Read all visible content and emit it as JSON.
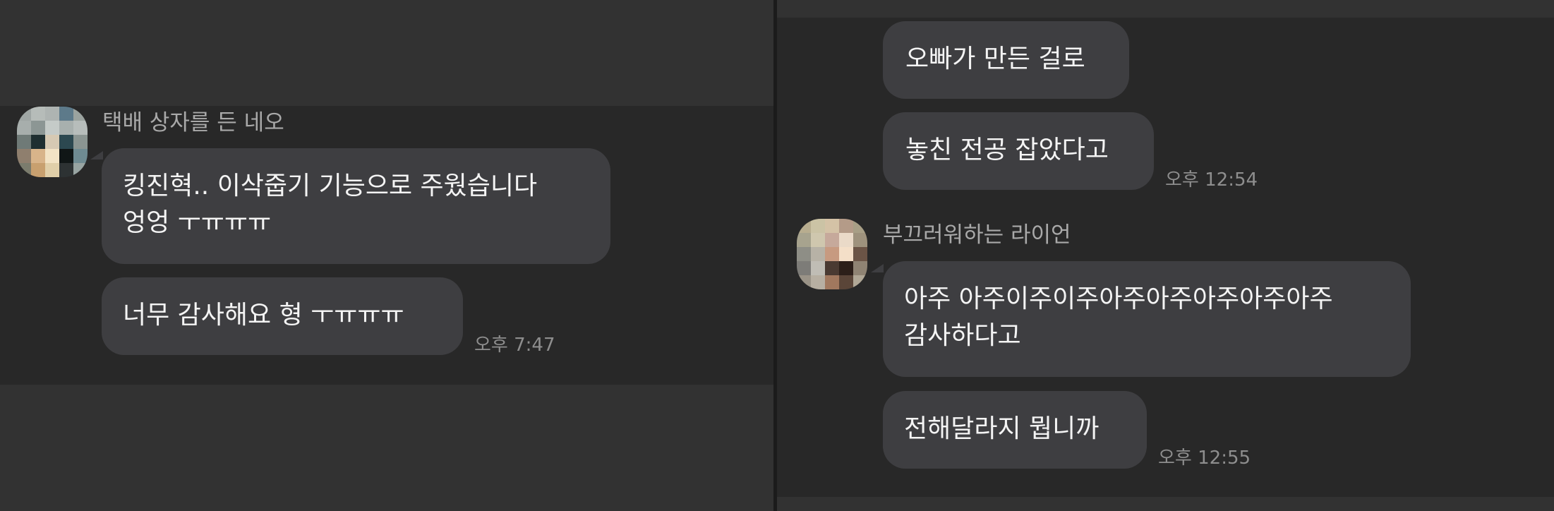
{
  "left_chat": {
    "sender_name": "택배 상자를 든 네오",
    "messages": [
      {
        "lines": [
          "킹진혁.. 이삭줍기 기능으로 주웠습니다",
          "엉엉 ㅜㅠㅠㅠ"
        ]
      },
      {
        "lines": [
          "너무 감사해요 형 ㅜㅠㅠㅠ"
        ]
      }
    ],
    "time": "오후 7:47"
  },
  "right_chat": {
    "group1": {
      "messages": [
        {
          "lines": [
            "오빠가 만든 걸로"
          ]
        },
        {
          "lines": [
            "놓친 전공 잡았다고"
          ]
        }
      ],
      "time": "오후 12:54"
    },
    "group2": {
      "sender_name": "부끄러워하는 라이언",
      "messages": [
        {
          "lines": [
            "아주 아주이주이주아주아주아주아주아주",
            "감사하다고"
          ]
        },
        {
          "lines": [
            "전해달라지 뭡니까"
          ]
        }
      ],
      "time": "오후 12:55"
    }
  },
  "colors": {
    "background": "#323232",
    "message_band": "#282828",
    "bubble": "#3e3e41",
    "message_text": "#f4f4f4",
    "sender_text": "#a9a9a9",
    "time_text": "#8e8e8e"
  },
  "avatars": {
    "left": "pixelated-profile-photo",
    "right": "pixelated-profile-photo"
  }
}
